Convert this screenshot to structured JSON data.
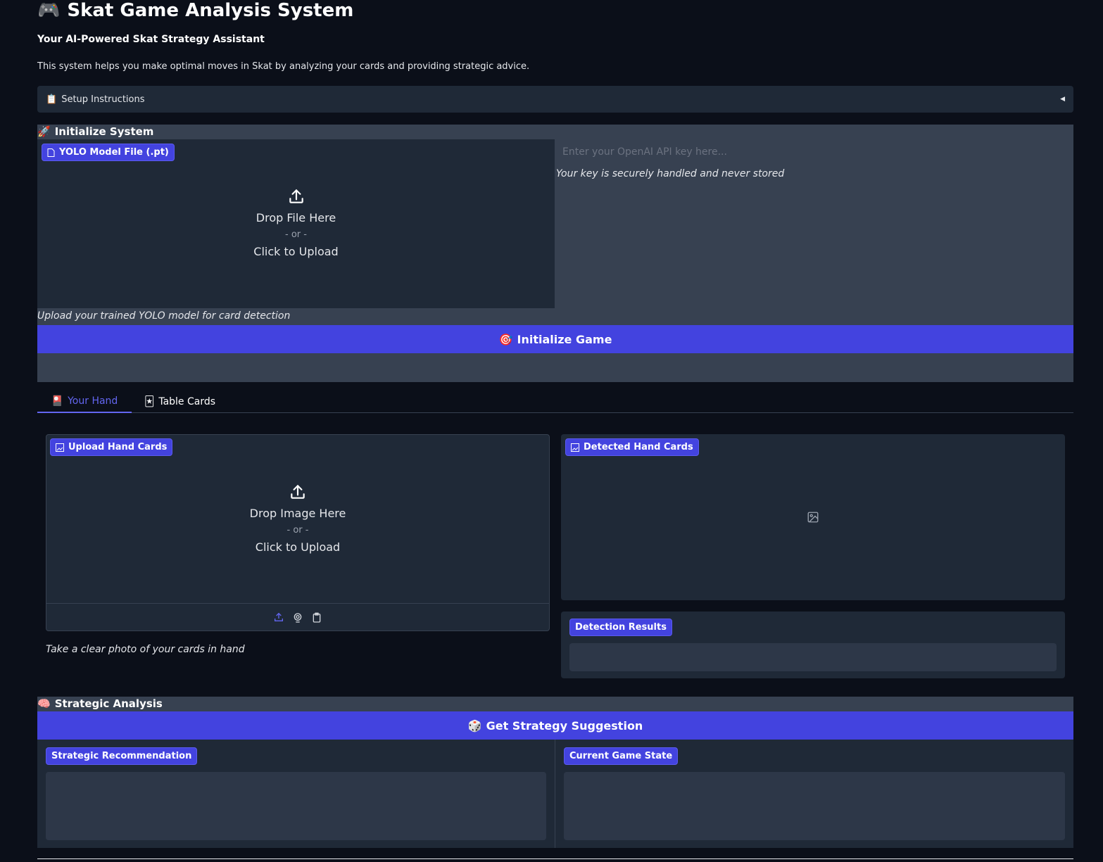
{
  "header": {
    "title_emoji": "🎮",
    "title": "Skat Game Analysis System",
    "subtitle": "Your AI-Powered Skat Strategy Assistant",
    "description": "This system helps you make optimal moves in Skat by analyzing your cards and providing strategic advice."
  },
  "accordion": {
    "emoji": "📋",
    "label": "Setup Instructions",
    "arrow": "◀"
  },
  "init": {
    "emoji": "🚀",
    "title": "Initialize System",
    "model_label": "YOLO Model File (.pt)",
    "drop_text": "Drop File Here",
    "or_text": "- or -",
    "click_text": "Click to Upload",
    "model_hint": "Upload your trained YOLO model for card detection",
    "api_placeholder": "Enter your OpenAI API key here...",
    "api_hint": "Your key is securely handled and never stored",
    "button_emoji": "🎯",
    "button_label": "Initialize Game"
  },
  "tabs": [
    {
      "emoji": "🎴",
      "label": "Your Hand",
      "active": true
    },
    {
      "emoji": "🃏",
      "label": "Table Cards",
      "active": false
    }
  ],
  "hand": {
    "upload_label": "Upload Hand Cards",
    "drop_text": "Drop Image Here",
    "or_text": "- or -",
    "click_text": "Click to Upload",
    "hint": "Take a clear photo of your cards in hand",
    "detected_label": "Detected Hand Cards",
    "results_label": "Detection Results"
  },
  "strategy": {
    "emoji": "🧠",
    "title": "Strategic Analysis",
    "button_emoji": "🎲",
    "button_label": "Get Strategy Suggestion",
    "recommendation_label": "Strategic Recommendation",
    "state_label": "Current Game State"
  },
  "colors": {
    "background": "#0b0f19",
    "accent": "#4343df",
    "panel": "#1f2937",
    "section": "#374151",
    "active_tab": "#6366f1"
  }
}
